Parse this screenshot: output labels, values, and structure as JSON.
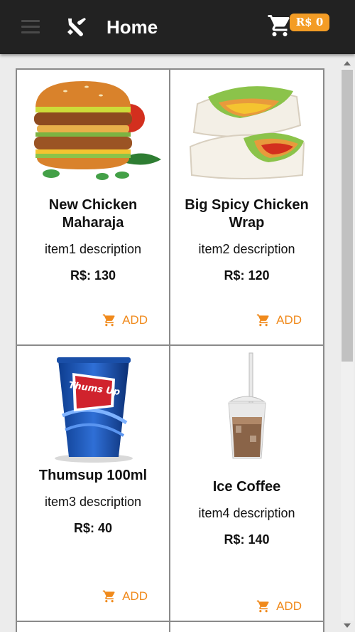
{
  "header": {
    "title": "Home",
    "menu_icon": "hamburger-menu-icon",
    "brand_icon": "fork-knife-icon",
    "cart_icon": "shopping-cart-icon",
    "cart_total": "R$ 0",
    "background": "#222222",
    "badge_color": "#f39c25"
  },
  "products": [
    {
      "name": "New Chicken Maharaja",
      "description": "item1 description",
      "price": "R$: 130",
      "add_label": "ADD",
      "image": "burger"
    },
    {
      "name": "Big Spicy Chicken Wrap",
      "description": "item2 description",
      "price": "R$: 120",
      "add_label": "ADD",
      "image": "wrap"
    },
    {
      "name": "Thumsup 100ml",
      "description": "item3 description",
      "price": "R$: 40",
      "add_label": "ADD",
      "image": "soda-cup"
    },
    {
      "name": "Ice Coffee",
      "description": "item4 description",
      "price": "R$: 140",
      "add_label": "ADD",
      "image": "iced-coffee"
    }
  ],
  "accent_color": "#f08a1c",
  "cup_logo_text": "Thums Up"
}
